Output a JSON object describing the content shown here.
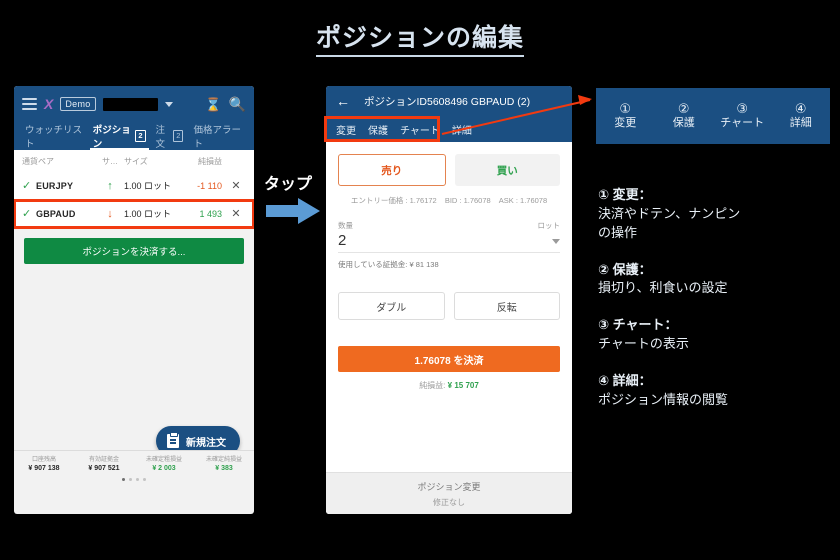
{
  "title": "ポジションの編集",
  "left_phone": {
    "header": {
      "menu_icon": "hamburger-icon",
      "logo": "X",
      "demo_badge": "Demo",
      "account_redacted": "",
      "history_icon": "hourglass-icon",
      "search_icon": "search-icon"
    },
    "tabs": [
      {
        "label": "ウォッチリスト",
        "count": "",
        "active": false
      },
      {
        "label": "ポジション",
        "count": "2",
        "active": true
      },
      {
        "label": "注文",
        "count": "2",
        "active": false
      },
      {
        "label": "価格アラート",
        "count": "",
        "active": false
      }
    ],
    "table": {
      "columns": [
        "通貨ペア",
        "サ…",
        "サイズ",
        "純損益"
      ],
      "rows": [
        {
          "pair": "EURJPY",
          "side": "up",
          "size": "1.00 ロット",
          "pl": "-1 110",
          "pl_sign": "neg",
          "close": "✕"
        },
        {
          "pair": "GBPAUD",
          "side": "down",
          "size": "1.00 ロット",
          "pl": "1 493",
          "pl_sign": "pos",
          "close": "✕"
        }
      ]
    },
    "close_all_button": "ポジションを決済する...",
    "new_order_button": "新規注文",
    "account_bar": [
      {
        "label": "口座残高",
        "value": "¥ 907 138",
        "sign": "neutral"
      },
      {
        "label": "有効証拠金",
        "value": "¥ 907 521",
        "sign": "neutral"
      },
      {
        "label": "未確定粗損益",
        "value": "¥ 2 003",
        "sign": "pos"
      },
      {
        "label": "未確定純損益",
        "value": "¥ 383",
        "sign": "pos"
      }
    ]
  },
  "tap": {
    "label": "タップ",
    "arrow_color": "#5b9bd5"
  },
  "mid_phone": {
    "back_icon": "back-arrow-icon",
    "title": "ポジションID5608496 GBPAUD (2)",
    "tabs": [
      "変更",
      "保護",
      "チャート",
      "詳細"
    ],
    "sell_button": "売り",
    "buy_button": "買い",
    "price_line": {
      "entry": "エントリー価格 : 1.76172",
      "bid": "BID : 1.76078",
      "ask": "ASK : 1.76078"
    },
    "quantity": {
      "label": "数量",
      "unit": "ロット",
      "value": "2",
      "margin_used": "使用している証拠金: ¥ 81 138"
    },
    "double_button": "ダブル",
    "reverse_button": "反転",
    "settle_button": "1.76078 を決済",
    "net_pl_label": "純損益:",
    "net_pl_value": "¥ 15 707",
    "footer_title": "ポジション変更",
    "footer_sub": "修正なし"
  },
  "legend_panel": {
    "items": [
      {
        "num": "①",
        "label": "変更"
      },
      {
        "num": "②",
        "label": "保護"
      },
      {
        "num": "③",
        "label": "チャート"
      },
      {
        "num": "④",
        "label": "詳細"
      }
    ]
  },
  "descriptions": [
    {
      "head": "① 変更：",
      "body": "決済やドテン、ナンピン\nの操作"
    },
    {
      "head": "② 保護：",
      "body": "損切り、利食いの設定"
    },
    {
      "head": "③ チャート：",
      "body": "チャートの表示"
    },
    {
      "head": "④ 詳細：",
      "body": "ポジション情報の閲覧"
    }
  ],
  "colors": {
    "header_blue": "#1b4f82",
    "accent_red": "#f23a10",
    "green": "#2fa14e",
    "orange": "#ef6a20",
    "tap_blue": "#5b9bd5"
  }
}
